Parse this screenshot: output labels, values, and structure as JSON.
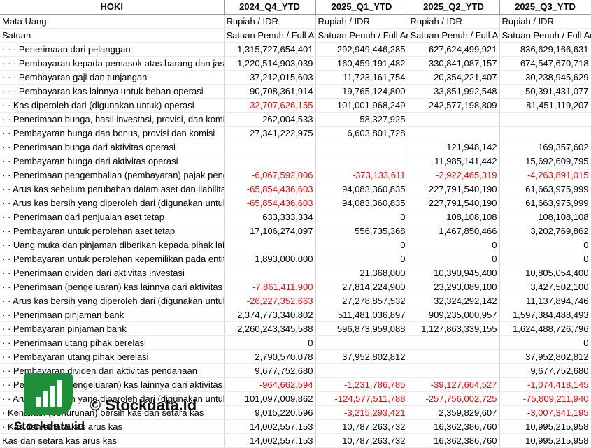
{
  "header": {
    "label_col": "HOKI",
    "periods": [
      "2024_Q4_YTD",
      "2025_Q1_YTD",
      "2025_Q2_YTD",
      "2025_Q3_YTD"
    ]
  },
  "meta_rows": [
    {
      "label": "Mata Uang",
      "values": [
        "Rupiah / IDR",
        "Rupiah / IDR",
        "Rupiah / IDR",
        "Rupiah / IDR"
      ]
    },
    {
      "label": "Satuan",
      "values": [
        "Satuan Penuh / Full Amount",
        "Satuan Penuh / Full Amount",
        "Satuan Penuh / Full Amount",
        "Satuan Penuh / Full Amount"
      ]
    }
  ],
  "rows": [
    {
      "label": "· · · Penerimaan dari pelanggan",
      "values": [
        "1,315,727,654,401",
        "292,949,446,285",
        "627,624,499,921",
        "836,629,166,631"
      ]
    },
    {
      "label": "· · · Pembayaran kepada pemasok atas barang dan jasa",
      "values": [
        "1,220,514,903,039",
        "160,459,191,482",
        "330,841,087,157",
        "674,547,670,718"
      ]
    },
    {
      "label": "· · · Pembayaran gaji dan tunjangan",
      "values": [
        "37,212,015,603",
        "11,723,161,754",
        "20,354,221,407",
        "30,238,945,629"
      ]
    },
    {
      "label": "· · · Pembayaran kas lainnya untuk beban operasi",
      "values": [
        "90,708,361,914",
        "19,765,124,800",
        "33,851,992,548",
        "50,391,431,077"
      ]
    },
    {
      "label": "· · Kas diperoleh dari (digunakan untuk) operasi",
      "values": [
        "-32,707,626,155",
        "101,001,968,249",
        "242,577,198,809",
        "81,451,119,207"
      ]
    },
    {
      "label": "· · Penerimaan bunga, hasil investasi, provisi, dan komisi",
      "values": [
        "262,004,533",
        "58,327,925",
        "",
        ""
      ]
    },
    {
      "label": "· · Pembayaran bunga dan bonus, provisi dan komisi",
      "values": [
        "27,341,222,975",
        "6,603,801,728",
        "",
        ""
      ]
    },
    {
      "label": "· · Penerimaan bunga dari aktivitas operasi",
      "values": [
        "",
        "",
        "121,948,142",
        "169,357,602"
      ]
    },
    {
      "label": "· · Pembayaran bunga dari aktivitas operasi",
      "values": [
        "",
        "",
        "11,985,141,442",
        "15,692,609,795"
      ]
    },
    {
      "label": "· · Penerimaan pengembalian (pembayaran) pajak penghasilan",
      "values": [
        "-6,067,592,006",
        "-373,133,611",
        "-2,922,465,319",
        "-4,263,891,015"
      ]
    },
    {
      "label": "· · Arus kas sebelum perubahan dalam aset dan liabilitas",
      "values": [
        "-65,854,436,603",
        "94,083,360,835",
        "227,791,540,190",
        "61,663,975,999"
      ]
    },
    {
      "label": "· · Arus kas bersih yang diperoleh dari (digunakan untuk)",
      "values": [
        "-65,854,436,603",
        "94,083,360,835",
        "227,791,540,190",
        "61,663,975,999"
      ]
    },
    {
      "label": "· · Penerimaan dari penjualan aset tetap",
      "values": [
        "633,333,334",
        "0",
        "108,108,108",
        "108,108,108"
      ]
    },
    {
      "label": "· · Pembayaran untuk perolehan aset tetap",
      "values": [
        "17,106,274,097",
        "556,735,368",
        "1,467,850,466",
        "3,202,769,862"
      ]
    },
    {
      "label": "· · Uang muka dan pinjaman diberikan kepada pihak lain, selain institusi keuangan",
      "values": [
        "",
        "0",
        "0",
        "0"
      ]
    },
    {
      "label": "· · Pembayaran untuk perolehan kepemilikan pada entitas",
      "values": [
        "1,893,000,000",
        "0",
        "0",
        "0"
      ]
    },
    {
      "label": "· · Penerimaan dividen dari aktivitas investasi",
      "values": [
        "",
        "21,368,000",
        "10,390,945,400",
        "10,805,054,400"
      ]
    },
    {
      "label": "· · Penerimaan (pengeluaran) kas lainnya dari aktivitas",
      "values": [
        "-7,861,411,900",
        "27,814,224,900",
        "23,293,089,100",
        "3,427,502,100"
      ]
    },
    {
      "label": "· · Arus kas bersih yang diperoleh dari (digunakan untuk)",
      "values": [
        "-26,227,352,663",
        "27,278,857,532",
        "32,324,292,142",
        "11,137,894,746"
      ]
    },
    {
      "label": "· · Penerimaan pinjaman bank",
      "values": [
        "2,374,773,340,802",
        "511,481,036,897",
        "909,235,000,957",
        "1,597,384,488,493"
      ]
    },
    {
      "label": "· · Pembayaran pinjaman bank",
      "values": [
        "2,260,243,345,588",
        "596,873,959,088",
        "1,127,863,339,155",
        "1,624,488,726,796"
      ]
    },
    {
      "label": "· · Penerimaan utang pihak berelasi",
      "values": [
        "0",
        "",
        "",
        "0"
      ]
    },
    {
      "label": "· · Pembayaran utang pihak berelasi",
      "values": [
        "2,790,570,078",
        "37,952,802,812",
        "",
        "37,952,802,812"
      ]
    },
    {
      "label": "· · Pembayaran dividen dari aktivitas pendanaan",
      "values": [
        "9,677,752,680",
        "",
        "",
        "9,677,752,680"
      ]
    },
    {
      "label": "· · Penerimaan (pengeluaran) kas lainnya dari aktivitas",
      "values": [
        "-964,662,594",
        "-1,231,786,785",
        "-39,127,664,527",
        "-1,074,418,145"
      ]
    },
    {
      "label": "· · Arus kas bersih yang diperoleh dari (digunakan untuk)",
      "values": [
        "101,097,009,862",
        "-124,577,511,788",
        "-257,756,002,725",
        "-75,809,211,940"
      ]
    },
    {
      "label": "· Kenaikan (penurunan) bersih kas dan setara kas",
      "values": [
        "9,015,220,596",
        "-3,215,293,421",
        "2,359,829,607",
        "-3,007,341,195"
      ]
    },
    {
      "label": "· Kas dan setara kas arus kas",
      "values": [
        "14,002,557,153",
        "10,787,263,732",
        "16,362,386,760",
        "10,995,215,958"
      ]
    },
    {
      "label": "Kas dan setara kas arus kas",
      "values": [
        "14,002,557,153",
        "10,787,263,732",
        "16,362,386,760",
        "10,995,215,958"
      ]
    }
  ],
  "watermark": {
    "text": "© Stockdata.id",
    "logo_text": "Stockdata.id",
    "logo_icon": "bar-chart-icon",
    "brand_color": "#1f8f3a"
  },
  "colors": {
    "negative": "#ff0000",
    "grid": "#d4d4d4"
  }
}
